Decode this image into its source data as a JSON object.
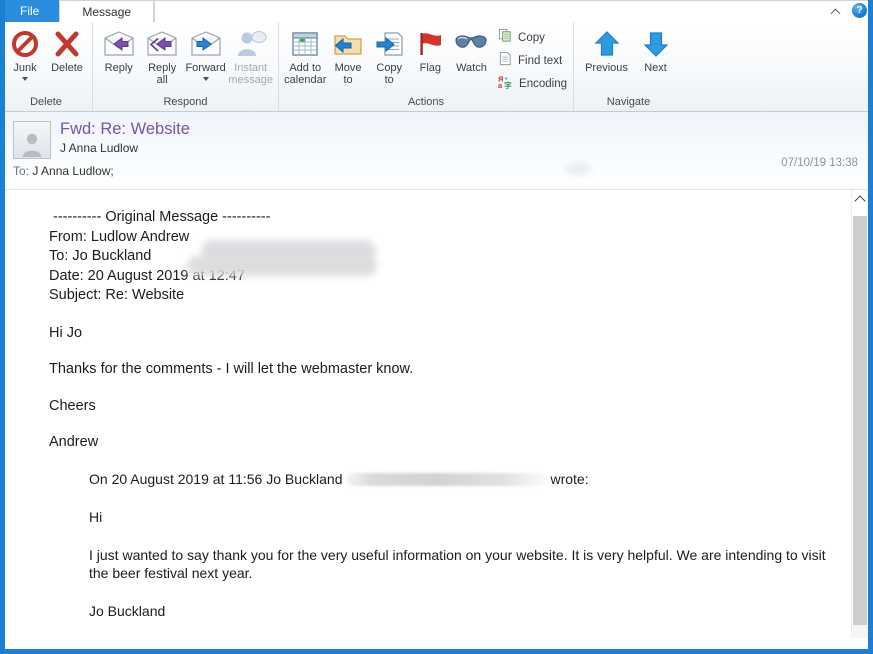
{
  "window": {
    "accent_color": "#1b7fd4",
    "tabs": [
      {
        "label": "File",
        "type": "file"
      },
      {
        "label": "Message",
        "type": "active"
      }
    ],
    "collapse_ribbon_icon": "chevron-up-icon",
    "help_icon": "help-icon",
    "help_label": "?"
  },
  "ribbon": {
    "groups": [
      {
        "label": "Delete",
        "buttons": [
          {
            "label": "Junk",
            "icon": "junk-no-entry-icon",
            "dropdown": true,
            "disabled": false
          },
          {
            "label": "Delete",
            "icon": "delete-x-icon",
            "dropdown": false,
            "disabled": false
          }
        ]
      },
      {
        "label": "Respond",
        "buttons": [
          {
            "label": "Reply",
            "icon": "reply-envelope-icon",
            "dropdown": false,
            "disabled": false
          },
          {
            "label": "Reply\nall",
            "icon": "reply-all-envelope-icon",
            "dropdown": false,
            "disabled": false
          },
          {
            "label": "Forward",
            "icon": "forward-envelope-icon",
            "dropdown": true,
            "disabled": false
          },
          {
            "label": "Instant\nmessage",
            "icon": "instant-message-person-icon",
            "dropdown": false,
            "disabled": true
          }
        ]
      },
      {
        "label": "Actions",
        "buttons": [
          {
            "label": "Add to\ncalendar",
            "icon": "calendar-icon",
            "dropdown": false,
            "disabled": false
          },
          {
            "label": "Move\nto",
            "icon": "move-to-folder-icon",
            "dropdown": false,
            "disabled": false
          },
          {
            "label": "Copy\nto",
            "icon": "copy-to-page-icon",
            "dropdown": false,
            "disabled": false
          },
          {
            "label": "Flag",
            "icon": "flag-icon",
            "dropdown": false,
            "disabled": false
          },
          {
            "label": "Watch",
            "icon": "watch-glasses-icon",
            "dropdown": false,
            "disabled": false
          }
        ],
        "small_buttons": [
          {
            "label": "Copy",
            "icon": "copy-icon"
          },
          {
            "label": "Find text",
            "icon": "find-text-page-icon"
          },
          {
            "label": "Encoding",
            "icon": "encoding-icon"
          }
        ]
      },
      {
        "label": "Navigate",
        "buttons": [
          {
            "label": "Previous",
            "icon": "arrow-up-icon",
            "dropdown": false,
            "disabled": false
          },
          {
            "label": "Next",
            "icon": "arrow-down-icon",
            "dropdown": false,
            "disabled": false
          }
        ]
      }
    ]
  },
  "message": {
    "subject": "Fwd: Re: Website",
    "sender": "J Anna Ludlow",
    "date": "07/10/19 13:38",
    "to_label": "To:",
    "to_value": "J Anna Ludlow;",
    "avatar_icon": "contact-avatar-icon",
    "subject_color": "#7b539e"
  },
  "body": {
    "original_header": {
      "separator": "---------- Original Message ----------",
      "from_label": "From: Ludlow Andrew",
      "to_label": "To: Jo Buckland",
      "date_label": "Date: 20 August 2019 at 12:47",
      "subject_label": "Subject: Re: Website"
    },
    "greeting": "Hi Jo",
    "paragraph": "Thanks for the comments - I will let the webmaster know.",
    "signoff": "Cheers",
    "signature": "Andrew",
    "quote": {
      "attribution_prefix": "On 20 August 2019 at 11:56 Jo Buckland",
      "attribution_suffix": "wrote:",
      "greeting": "Hi",
      "paragraph": "I just wanted to say thank you for the very useful information on your website.  It is very helpful.  We are intending to visit the beer festival next year.",
      "signature": "Jo Buckland"
    }
  },
  "scrollbar": {
    "up_arrow_icon": "scroll-up-arrow-icon",
    "thumb": "scroll-thumb"
  }
}
